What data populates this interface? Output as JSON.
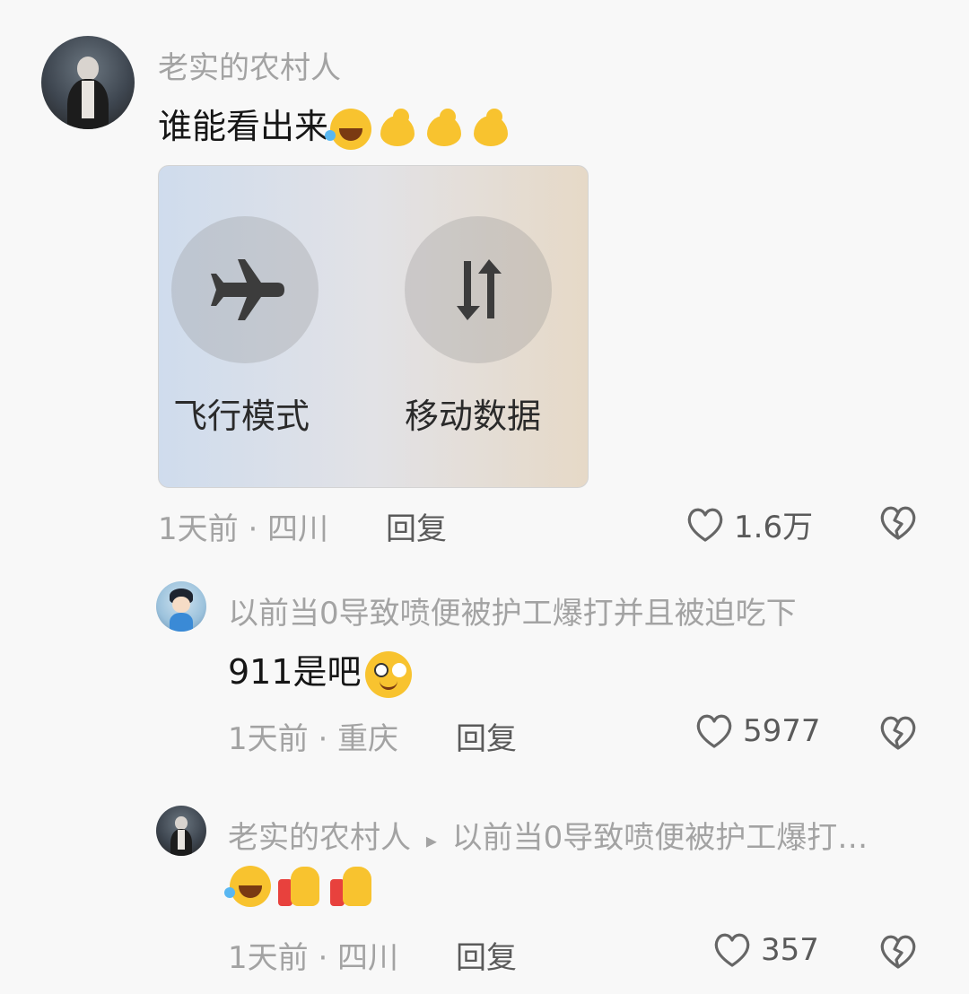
{
  "comments": [
    {
      "username": "老实的农村人",
      "text": "谁能看出来",
      "time_location": "1天前 · 四川",
      "reply_label": "回复",
      "likes": "1.6万",
      "image": {
        "tiles": [
          {
            "label": "飞行模式",
            "icon": "airplane-icon"
          },
          {
            "label": "移动数据",
            "icon": "mobile-data-icon"
          }
        ]
      }
    },
    {
      "username": "以前当0导致喷便被护工爆打并且被迫吃下",
      "text": "911是吧",
      "time_location": "1天前 · 重庆",
      "reply_label": "回复",
      "likes": "5977"
    },
    {
      "username": "老实的农村人",
      "reply_to_arrow": "▸",
      "reply_to": "以前当0导致喷便被护工爆打…",
      "text": "",
      "time_location": "1天前 · 四川",
      "reply_label": "回复",
      "likes": "357"
    }
  ]
}
